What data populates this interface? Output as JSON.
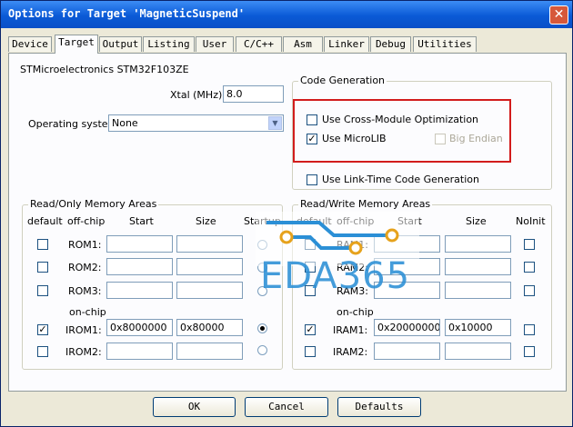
{
  "window": {
    "title": "Options for Target 'MagneticSuspend'",
    "close_glyph": "✕"
  },
  "tabs": [
    "Device",
    "Target",
    "Output",
    "Listing",
    "User",
    "C/C++",
    "Asm",
    "Linker",
    "Debug",
    "Utilities"
  ],
  "active_tab": "Target",
  "device": {
    "name": "STMicroelectronics STM32F103ZE"
  },
  "xtal": {
    "label": "Xtal (MHz):",
    "value": "8.0"
  },
  "os": {
    "label": "Operating system:",
    "value": "None"
  },
  "code_gen": {
    "title": "Code Generation",
    "cross_module": {
      "label": "Use Cross-Module Optimization",
      "checked": false
    },
    "microlib": {
      "label": "Use MicroLIB",
      "checked": true
    },
    "big_endian": {
      "label": "Big Endian",
      "checked": false,
      "enabled": false
    },
    "link_time": {
      "label": "Use Link-Time Code Generation",
      "checked": false
    }
  },
  "highlight_color": "#d21c1c",
  "ro": {
    "title": "Read/Only Memory Areas",
    "headers": {
      "default": "default",
      "offchip": "off-chip",
      "start": "Start",
      "size": "Size",
      "startup": "Startup"
    },
    "onchip_label": "on-chip",
    "rows": [
      {
        "name": "ROM1:",
        "default": false,
        "start": "",
        "size": "",
        "startup": false
      },
      {
        "name": "ROM2:",
        "default": false,
        "start": "",
        "size": "",
        "startup": false
      },
      {
        "name": "ROM3:",
        "default": false,
        "start": "",
        "size": "",
        "startup": false
      },
      {
        "name": "IROM1:",
        "default": true,
        "start": "0x8000000",
        "size": "0x80000",
        "startup": true
      },
      {
        "name": "IROM2:",
        "default": false,
        "start": "",
        "size": "",
        "startup": false
      }
    ]
  },
  "rw": {
    "title": "Read/Write Memory Areas",
    "headers": {
      "default": "default",
      "offchip": "off-chip",
      "start": "Start",
      "size": "Size",
      "noinit": "NoInit"
    },
    "onchip_label": "on-chip",
    "rows": [
      {
        "name": "RAM1:",
        "default": false,
        "start": "",
        "size": "",
        "noinit": false
      },
      {
        "name": "RAM2:",
        "default": false,
        "start": "",
        "size": "",
        "noinit": false
      },
      {
        "name": "RAM3:",
        "default": false,
        "start": "",
        "size": "",
        "noinit": false
      },
      {
        "name": "IRAM1:",
        "default": true,
        "start": "0x20000000",
        "size": "0x10000",
        "noinit": false
      },
      {
        "name": "IRAM2:",
        "default": false,
        "start": "",
        "size": "",
        "noinit": false
      }
    ]
  },
  "buttons": {
    "ok": "OK",
    "cancel": "Cancel",
    "defaults": "Defaults"
  },
  "watermark": {
    "text": "EDA365",
    "color": "#2b8fd6"
  }
}
